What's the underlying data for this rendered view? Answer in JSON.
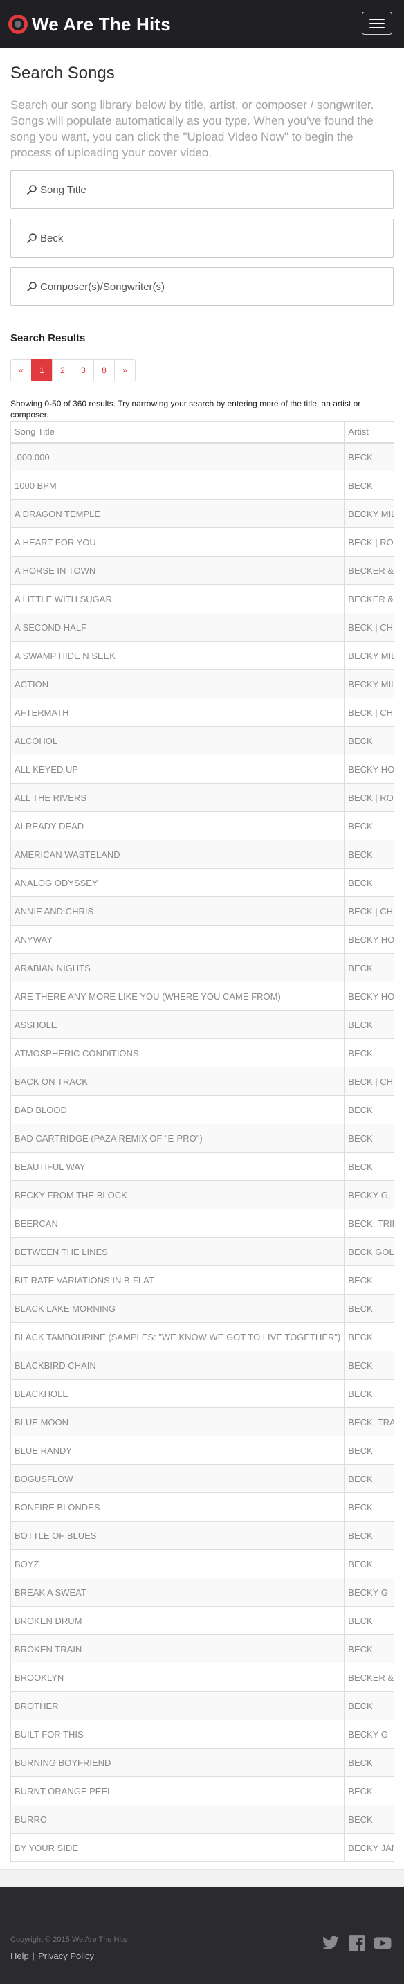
{
  "header": {
    "brand": "We Are The Hits",
    "logo_icon": "record-logo-icon",
    "menu_icon": "hamburger-menu-icon",
    "accent_color": "#e03a3e"
  },
  "page": {
    "title": "Search Songs",
    "intro": "Search our song library below by title, artist, or composer / songwriter. Songs will populate automatically as you type. When you've found the song you want, you can click the \"Upload Video Now\" to begin the process of uploading your cover video."
  },
  "search": {
    "title_placeholder": "Song Title",
    "title_value": "",
    "artist_placeholder": "Artist",
    "artist_value": "Beck",
    "composer_placeholder": "Composer(s)/Songwriter(s)",
    "composer_value": ""
  },
  "results": {
    "heading": "Search Results",
    "pagination": {
      "prev": "«",
      "pages": [
        "1",
        "2",
        "3",
        "8"
      ],
      "active": "1",
      "next": "»"
    },
    "summary": "Showing 0-50 of 360 results. Try narrowing your search by entering more of the title, an artist or composer.",
    "columns": [
      "Song Title",
      "Artist"
    ],
    "rows": [
      [
        ".000.000",
        "BECK"
      ],
      [
        "1000 BPM",
        "BECK"
      ],
      [
        "A DRAGON TEMPLE",
        "BECKY MILL"
      ],
      [
        "A HEART FOR YOU",
        "BECK | ROE"
      ],
      [
        "A HORSE IN TOWN",
        "BECKER & F"
      ],
      [
        "A LITTLE WITH SUGAR",
        "BECKER & F"
      ],
      [
        "A SECOND HALF",
        "BECK | CHR"
      ],
      [
        "A SWAMP HIDE N SEEK",
        "BECKY MILL"
      ],
      [
        "ACTION",
        "BECKY MILL"
      ],
      [
        "AFTERMATH",
        "BECK | CHR"
      ],
      [
        "ALCOHOL",
        "BECK"
      ],
      [
        "ALL KEYED UP",
        "BECKY HOB"
      ],
      [
        "ALL THE RIVERS",
        "BECK | ROE"
      ],
      [
        "ALREADY DEAD",
        "BECK"
      ],
      [
        "AMERICAN WASTELAND",
        "BECK"
      ],
      [
        "ANALOG ODYSSEY",
        "BECK"
      ],
      [
        "ANNIE AND CHRIS",
        "BECK | CHR"
      ],
      [
        "ANYWAY",
        "BECKY HOB"
      ],
      [
        "ARABIAN NIGHTS",
        "BECK"
      ],
      [
        "ARE THERE ANY MORE LIKE YOU (WHERE YOU CAME FROM)",
        "BECKY HOB"
      ],
      [
        "ASSHOLE",
        "BECK"
      ],
      [
        "ATMOSPHERIC CONDITIONS",
        "BECK"
      ],
      [
        "BACK ON TRACK",
        "BECK | CHR"
      ],
      [
        "BAD BLOOD",
        "BECK"
      ],
      [
        "BAD CARTRIDGE (PAZA REMIX OF \"E-PRO\")",
        "BECK"
      ],
      [
        "BEAUTIFUL WAY",
        "BECK"
      ],
      [
        "BECKY FROM THE BLOCK",
        "BECKY G, D"
      ],
      [
        "BEERCAN",
        "BECK, TRIBU"
      ],
      [
        "BETWEEN THE LINES",
        "BECK GOLD"
      ],
      [
        "BIT RATE VARIATIONS IN B-FLAT",
        "BECK"
      ],
      [
        "BLACK LAKE MORNING",
        "BECK"
      ],
      [
        "BLACK TAMBOURINE (SAMPLES: \"WE KNOW WE GOT TO LIVE TOGETHER\")",
        "BECK"
      ],
      [
        "BLACKBIRD CHAIN",
        "BECK"
      ],
      [
        "BLACKHOLE",
        "BECK"
      ],
      [
        "BLUE MOON",
        "BECK, TRAC"
      ],
      [
        "BLUE RANDY",
        "BECK"
      ],
      [
        "BOGUSFLOW",
        "BECK"
      ],
      [
        "BONFIRE BLONDES",
        "BECK"
      ],
      [
        "BOTTLE OF BLUES",
        "BECK"
      ],
      [
        "BOYZ",
        "BECK"
      ],
      [
        "BREAK A SWEAT",
        "BECKY G"
      ],
      [
        "BROKEN DRUM",
        "BECK"
      ],
      [
        "BROKEN TRAIN",
        "BECK"
      ],
      [
        "BROOKLYN",
        "BECKER & F"
      ],
      [
        "BROTHER",
        "BECK"
      ],
      [
        "BUILT FOR THIS",
        "BECKY G"
      ],
      [
        "BURNING BOYFRIEND",
        "BECK"
      ],
      [
        "BURNT ORANGE PEEL",
        "BECK"
      ],
      [
        "BURRO",
        "BECK"
      ],
      [
        "BY YOUR SIDE",
        "BECKY JANE"
      ]
    ]
  },
  "footer": {
    "copyright": "Copyright © 2015 We Are The Hits",
    "help": "Help",
    "separator": "|",
    "privacy": "Privacy Policy",
    "social_icons": [
      "twitter-icon",
      "facebook-icon",
      "youtube-icon"
    ],
    "icon_color": "#8a8a8f"
  }
}
